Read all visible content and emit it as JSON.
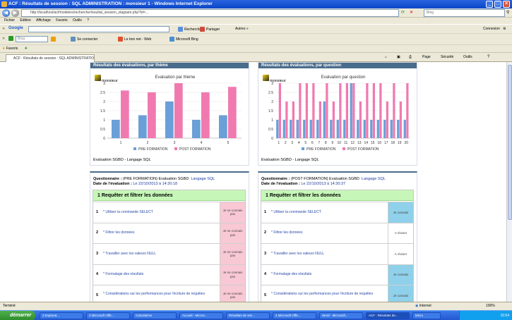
{
  "window": {
    "title": "ACF : Résultats de session : SQL ADMINISTRATION : monsieur 1 - Windows Internet Explorer"
  },
  "address": {
    "url": "http://localhost/acf/modeles/recherche/resultat_session_stagiaire.php?id=...",
    "search_placeholder": "Bing"
  },
  "menu": [
    "Fichier",
    "Edition",
    "Affichage",
    "Favoris",
    "Outils",
    "?"
  ],
  "toolbar1": {
    "google_label": "Google",
    "items": [
      "Rechercher",
      "Partager",
      "Autres »"
    ],
    "right": "Connexion"
  },
  "toolbar2": {
    "search_placeholder": "Bing",
    "items": [
      "Se connecter",
      "Le bon net - Web",
      "Microsoft Bing"
    ]
  },
  "favbar": {
    "favorites": "Favoris"
  },
  "tab": {
    "label": "ACF : Résultats de session : SQL ADMINISTRATION : m..."
  },
  "cmdbar": {
    "items": [
      "Page",
      "Sécurité",
      "Outils"
    ]
  },
  "panel_left": {
    "header": "Résultats des évaluations, par thème",
    "logo_text": "monsieur",
    "chart_title": "Evaluation par thème",
    "footer": "Evaluation SGBD - Langage SQL"
  },
  "panel_right": {
    "header": "Résultats des évaluations, par question",
    "logo_text": "monsieur",
    "chart_title": "Evaluation par question",
    "footer": "Evaluation SGBD - Langage SQL"
  },
  "chart_data": [
    {
      "type": "bar",
      "title": "Evaluation par thème",
      "categories": [
        "1",
        "2",
        "3",
        "4",
        "5"
      ],
      "ylim": [
        0,
        3
      ],
      "yticks": [
        "0",
        "0.5",
        "1",
        "1.5",
        "2",
        "2.5",
        "3"
      ],
      "legend": "bottom",
      "series": [
        {
          "name": "PRE FORMATION",
          "color": "#6a9fd8",
          "values": [
            1,
            1.25,
            2,
            1,
            1.25
          ]
        },
        {
          "name": "POST FORMATION",
          "color": "#f07ab0",
          "values": [
            2.6,
            2.5,
            3,
            2.5,
            2.8
          ]
        }
      ]
    },
    {
      "type": "bar",
      "title": "Evaluation par question",
      "categories": [
        "1",
        "2",
        "3",
        "4",
        "5",
        "6",
        "7",
        "8",
        "9",
        "10",
        "11",
        "12",
        "13",
        "14",
        "15",
        "16",
        "17",
        "18",
        "19",
        "20"
      ],
      "ylim": [
        0,
        3
      ],
      "yticks": [
        "0",
        "0.5",
        "1",
        "1.5",
        "2",
        "2.5",
        "3"
      ],
      "legend": "bottom",
      "series": [
        {
          "name": "PRE FORMATION",
          "color": "#6a9fd8",
          "values": [
            1,
            1,
            1,
            1,
            1,
            1,
            1,
            2,
            1,
            1,
            1,
            3,
            1,
            1,
            1,
            1,
            1,
            1,
            1,
            1
          ]
        },
        {
          "name": "POST FORMATION",
          "color": "#f07ab0",
          "values": [
            3,
            2,
            2,
            3,
            3,
            3,
            2,
            3,
            2,
            3,
            3,
            3,
            2,
            3,
            3,
            3,
            2,
            3,
            2,
            3
          ]
        }
      ]
    }
  ],
  "quest_left": {
    "line1_label": "Questionnaire :",
    "line1_value": "(PRE FORMATION) Evaluation SGBD",
    "line1_sub": "Langage SQL",
    "line2_label": "Date de l'évaluation :",
    "line2_value": "Le 22/10/2013 à 14:30:18",
    "section": "1  Requêter et filtrer les données",
    "rows": [
      {
        "num": "1",
        "label": "* Utiliser la commande SELECT",
        "answer": "Je ne connais pas"
      },
      {
        "num": "2",
        "label": "* Filtrer les données",
        "answer": "Je ne connais pas"
      },
      {
        "num": "3",
        "label": "* Travailler avec les valeurs NULL",
        "answer": "Je ne connais pas"
      },
      {
        "num": "4",
        "label": "* Formatage des résultats",
        "answer": "Je ne connais pas"
      },
      {
        "num": "5",
        "label": "* Considérations sur les performances pour l'écriture de requêtes",
        "answer": "Je ne connais pas"
      }
    ],
    "answer_color": "#f8c8d4"
  },
  "quest_right": {
    "line1_label": "Questionnaire :",
    "line1_value": "(POST FORMATION) Evaluation SGBD",
    "line1_sub": "Langage SQL",
    "line2_label": "Date de l'évaluation :",
    "line2_value": "Le 22/10/2013 à 14:30:37",
    "section": "1  Requêter et filtrer les données",
    "rows": [
      {
        "num": "1",
        "label": "* Utiliser la commande SELECT",
        "answer": "Je connais",
        "color": "#8fd0ea"
      },
      {
        "num": "2",
        "label": "* Filtrer les données",
        "answer": "A réviser",
        "color": "#ffffff"
      },
      {
        "num": "3",
        "label": "* Travailler avec les valeurs NULL",
        "answer": "A réviser",
        "color": "#ffffff"
      },
      {
        "num": "4",
        "label": "* Formatage des résultats",
        "answer": "Je connais",
        "color": "#8fd0ea"
      },
      {
        "num": "5",
        "label": "* Considérations sur les performances pour l'écriture de requêtes",
        "answer": "Je connais",
        "color": "#8fd0ea"
      }
    ]
  },
  "status": {
    "left": "Terminé",
    "zone": "Internet",
    "zoom": "100%"
  },
  "taskbar": {
    "start": "démarrer",
    "tasks": [
      "3 Explorat...",
      "2 Microsoft Offic...",
      "Calculatrice",
      "Accueil - Micros...",
      "Résultats de ses...",
      "4 Microsoft Offic...",
      "Word - Microsoft...",
      "ACF : Résultats de...",
      "Micro"
    ],
    "clock": "15:54"
  }
}
